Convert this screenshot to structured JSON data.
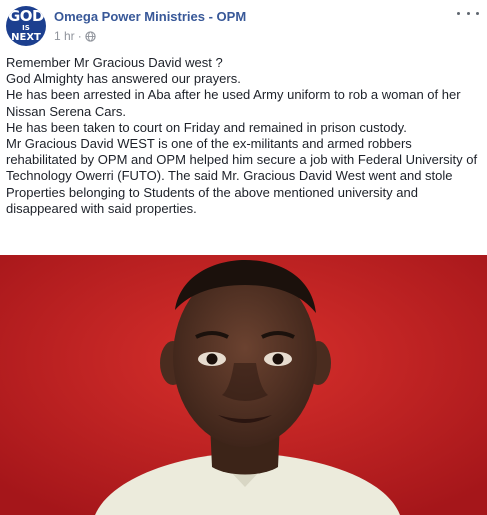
{
  "post": {
    "page_name": "Omega Power Ministries - OPM",
    "timestamp": "1 hr",
    "separator": "·",
    "privacy_icon": "globe-icon",
    "more_icon": "more-options-icon",
    "avatar": {
      "line1": "GOD",
      "line2": "IS",
      "line3": "NEXT"
    },
    "paragraphs": [
      "Remember Mr Gracious David west ?",
      "God Almighty has answered our prayers.",
      "He has been arrested in Aba after he used Army uniform to rob a woman of her Nissan Serena Cars.",
      "He has been taken to court on Friday and remained in prison custody.",
      "Mr Gracious David WEST is one of the ex-militants and armed robbers rehabilitated by OPM and OPM helped him secure a job with Federal University of Technology Owerri (FUTO). The said Mr. Gracious David West went and stole Properties belonging to Students of the above mentioned university and disappeared with said properties."
    ],
    "photo_background": "#c41f20",
    "link_color": "#385898"
  }
}
